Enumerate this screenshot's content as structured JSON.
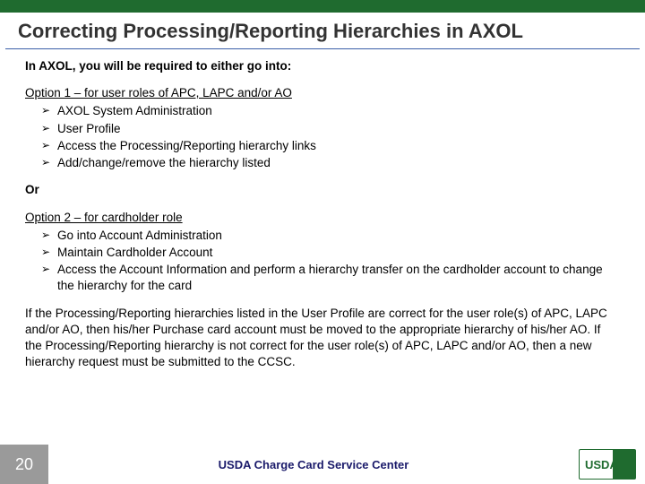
{
  "title": "Correcting Processing/Reporting Hierarchies in AXOL",
  "intro": "In AXOL, you will be required to either go into:",
  "option1": {
    "heading": "Option 1 – for user roles of APC, LAPC and/or AO",
    "items": [
      "AXOL System Administration",
      "User Profile",
      "Access the Processing/Reporting hierarchy links",
      "Add/change/remove the hierarchy listed"
    ]
  },
  "or_label": "Or",
  "option2": {
    "heading": "Option 2 – for cardholder role",
    "items": [
      "Go into Account Administration",
      "Maintain Cardholder Account",
      "Access the Account Information and perform a hierarchy transfer on the cardholder account to change the hierarchy for the card"
    ]
  },
  "closing": "If the Processing/Reporting hierarchies listed in the User Profile are correct for the user role(s) of APC, LAPC and/or AO, then his/her Purchase card account must be moved to the appropriate hierarchy of his/her AO.  If the Processing/Reporting hierarchy is not correct for the user role(s) of APC, LAPC and/or AO, then a new hierarchy request must be submitted to the CCSC.",
  "footer": {
    "page": "20",
    "center": "USDA Charge Card Service Center",
    "logo_text": "USDA"
  }
}
